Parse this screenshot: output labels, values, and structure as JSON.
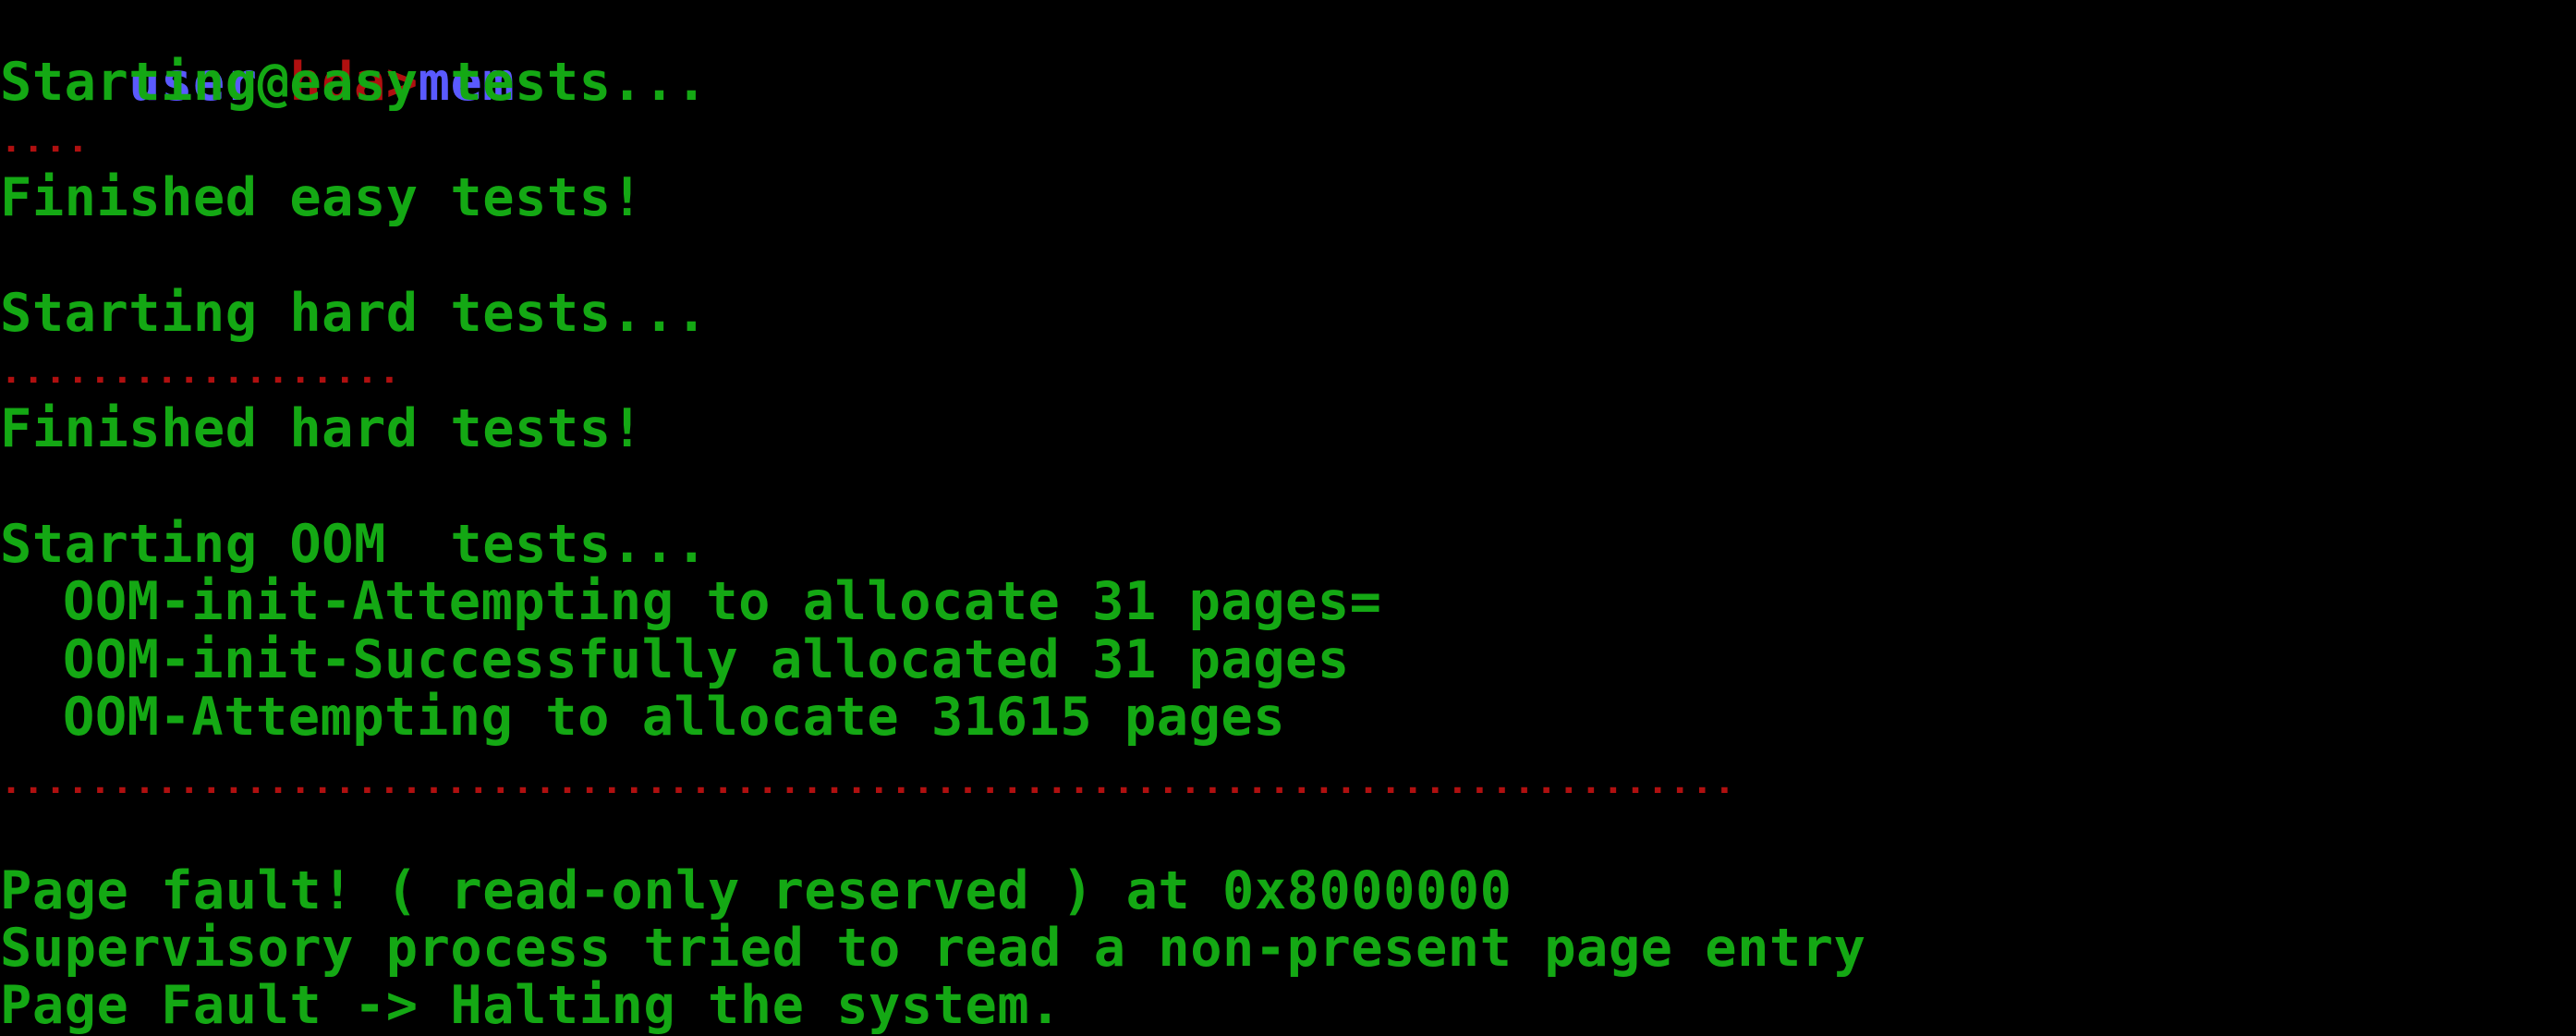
{
  "prompt": {
    "user": "user",
    "at": "@",
    "host": "hda",
    "arrow": ">",
    "command": "mem"
  },
  "output": {
    "easy_start": "Starting easy tests...",
    "easy_dots": "....",
    "easy_done": "Finished easy tests!",
    "hard_start": "Starting hard tests...",
    "hard_dots": "..................",
    "hard_done": "Finished hard tests!",
    "oom_start": "Starting OOM  tests...",
    "oom_init_attempt": "OOM-init-Attempting to allocate 31 pages=",
    "oom_init_success": "OOM-init-Successfully allocated 31 pages",
    "oom_attempt": "OOM-Attempting to allocate 31615 pages",
    "oom_dots": "..............................................................................",
    "fault": "Page fault! ( read-only reserved ) at 0x8000000",
    "supervisory": "Supervisory process tried to read a non-present page entry",
    "halt": "Page Fault -> Halting the system."
  },
  "colors": {
    "background": "#000000",
    "text": "#14a814",
    "dots": "#b01010",
    "user": "#5a5aff",
    "host": "#b01010"
  }
}
